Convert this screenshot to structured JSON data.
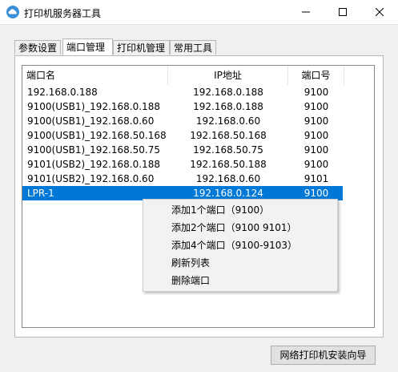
{
  "window": {
    "title": "打印机服务器工具",
    "minimize_glyph": "—",
    "maximize_glyph": "☐",
    "close_glyph": "✕",
    "icon": "cloud-icon"
  },
  "tabs": [
    {
      "label": "参数设置"
    },
    {
      "label": "端口管理"
    },
    {
      "label": "打印机管理"
    },
    {
      "label": "常用工具"
    }
  ],
  "port_list": {
    "columns": [
      "端口名",
      "IP地址",
      "端口号"
    ],
    "rows": [
      {
        "name": "192.168.0.188",
        "ip": "192.168.0.188",
        "port": "9100"
      },
      {
        "name": "9100(USB1)_192.168.0.188",
        "ip": "192.168.0.188",
        "port": "9100"
      },
      {
        "name": "9100(USB1)_192.168.0.60",
        "ip": "192.168.0.60",
        "port": "9100"
      },
      {
        "name": "9100(USB1)_192.168.50.168",
        "ip": "192.168.50.168",
        "port": "9100"
      },
      {
        "name": "9100(USB1)_192.168.50.75",
        "ip": "192.168.50.75",
        "port": "9100"
      },
      {
        "name": "9101(USB2)_192.168.0.188",
        "ip": "192.168.50.188",
        "port": "9100"
      },
      {
        "name": "9101(USB2)_192.168.0.60",
        "ip": "192.168.0.60",
        "port": "9101"
      },
      {
        "name": "LPR-1",
        "ip": "192.168.0.124",
        "port": "9100"
      }
    ],
    "selection_color": "#0078d7"
  },
  "context_menu": {
    "items": [
      {
        "label": "添加1个端口（9100）"
      },
      {
        "label": "添加2个端口（9100 9101）"
      },
      {
        "label": "添加4个端口（9100-9103）"
      },
      {
        "label": "刷新列表"
      },
      {
        "label": "删除端口"
      }
    ]
  },
  "footer": {
    "wizard_button": "网络打印机安装向导"
  }
}
